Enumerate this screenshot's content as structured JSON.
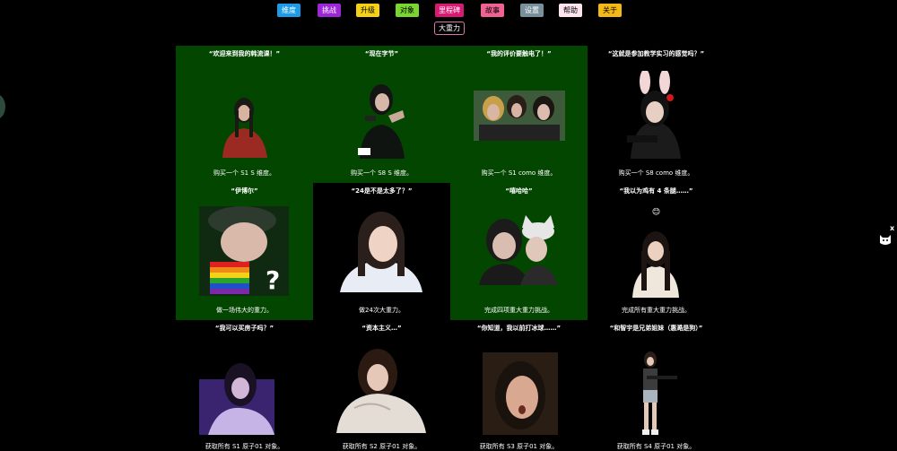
{
  "nav": {
    "items": [
      {
        "label": "维度",
        "bg": "#1e9be6",
        "color": "#fff"
      },
      {
        "label": "挑战",
        "bg": "#9c27d6",
        "color": "#fff"
      },
      {
        "label": "升级",
        "bg": "#f5d015",
        "color": "#000"
      },
      {
        "label": "对象",
        "bg": "#79d631",
        "color": "#000"
      },
      {
        "label": "里程碑",
        "bg": "#d81b72",
        "color": "#fff"
      },
      {
        "label": "故事",
        "bg": "#f06292",
        "color": "#000"
      },
      {
        "label": "设置",
        "bg": "#78909c",
        "color": "#fff"
      },
      {
        "label": "帮助",
        "bg": "#ffe4f0",
        "color": "#000"
      },
      {
        "label": "关于",
        "bg": "#f5b915",
        "color": "#000"
      }
    ],
    "sub_tab": "大重力"
  },
  "achievements": [
    {
      "title": "“欢迎来到我的韩流课！”",
      "caption": "购买一个 S1 S 维度。",
      "icon": "portrait-red-sweater",
      "done": true
    },
    {
      "title": "“现在字节”",
      "caption": "购买一个 S8 S 维度。",
      "icon": "portrait-gun-pose",
      "done": true
    },
    {
      "title": "“我的评价要触电了！”",
      "caption": "购买一个 S1 como 维度。",
      "icon": "group-photo",
      "done": true
    },
    {
      "title": "“这就是参加教学实习的感觉吗？”",
      "caption": "购买一个 S8 como 维度。",
      "icon": "portrait-bunny-ears",
      "done": false
    },
    {
      "title": "“伊博尔”",
      "caption": "做一场伟大的重力。",
      "icon": "portrait-rainbow-flag",
      "done": true
    },
    {
      "title": "“24是不是太多了？”",
      "caption": "做24次大重力。",
      "icon": "portrait-smiling",
      "done": false
    },
    {
      "title": "“嘻哈哈”",
      "caption": "完成四项重大重力挑战。",
      "icon": "duo-cat-hat",
      "done": true
    },
    {
      "title": "“我以为鸡有 4 条腿……”",
      "caption": "完成所有重大重力挑战。",
      "icon": "portrait-standing",
      "emoji": "😊",
      "done": false
    },
    {
      "title": "“我可以买房子吗？”",
      "caption": "获取所有 S1 原子01 对象。",
      "icon": "portrait-purple-light",
      "done": false
    },
    {
      "title": "“资本主义…”",
      "caption": "获取所有 S2 原子01 对象。",
      "icon": "portrait-blanket",
      "done": false
    },
    {
      "title": "“你知道，我以前打冰球……”",
      "caption": "获取所有 S3 原子01 对象。",
      "icon": "portrait-surprised",
      "done": false
    },
    {
      "title": "“和智宇是兄弟姐妹（惠澔是狗）”",
      "caption": "获取所有 S4 原子01 对象。",
      "icon": "figure-with-rifle",
      "done": false
    }
  ],
  "widget": {
    "close": "x",
    "icon": "cat-icon"
  }
}
